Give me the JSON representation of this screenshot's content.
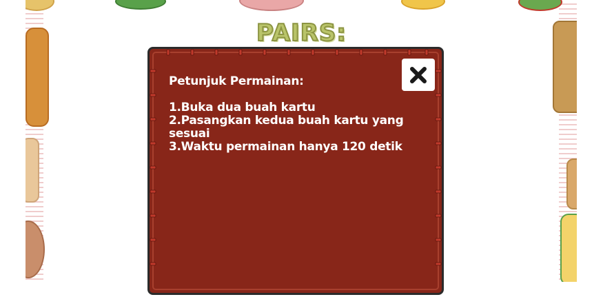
{
  "game": {
    "title": "PAIRS:"
  },
  "modal": {
    "heading": "Petunjuk Permainan:",
    "steps": [
      "1.Buka dua buah kartu",
      "2.Pasangkan kedua buah kartu yang sesuai",
      "3.Waktu permainan hanya 120 detik"
    ],
    "close_icon": "close-icon"
  },
  "colors": {
    "modal_background": "#882619",
    "title": "#b9c46a",
    "text": "#ffffff"
  }
}
